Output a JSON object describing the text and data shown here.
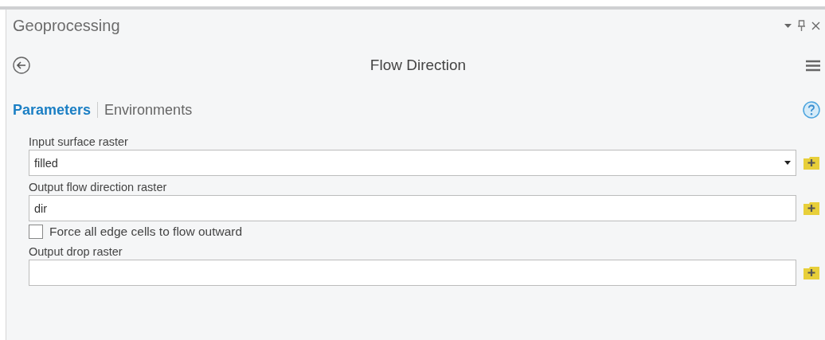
{
  "pane": {
    "title": "Geoprocessing"
  },
  "tool": {
    "title": "Flow Direction"
  },
  "tabs": [
    {
      "label": "Parameters",
      "selected": true
    },
    {
      "label": "Environments",
      "selected": false
    }
  ],
  "parameters": [
    {
      "kind": "dropdown",
      "label": "Input surface raster",
      "value": "filled"
    },
    {
      "kind": "text",
      "label": "Output flow direction raster",
      "value": "dir"
    },
    {
      "kind": "checkbox",
      "label": "Force all edge cells to flow outward",
      "checked": false
    },
    {
      "kind": "text",
      "label": "Output drop raster"
    }
  ]
}
